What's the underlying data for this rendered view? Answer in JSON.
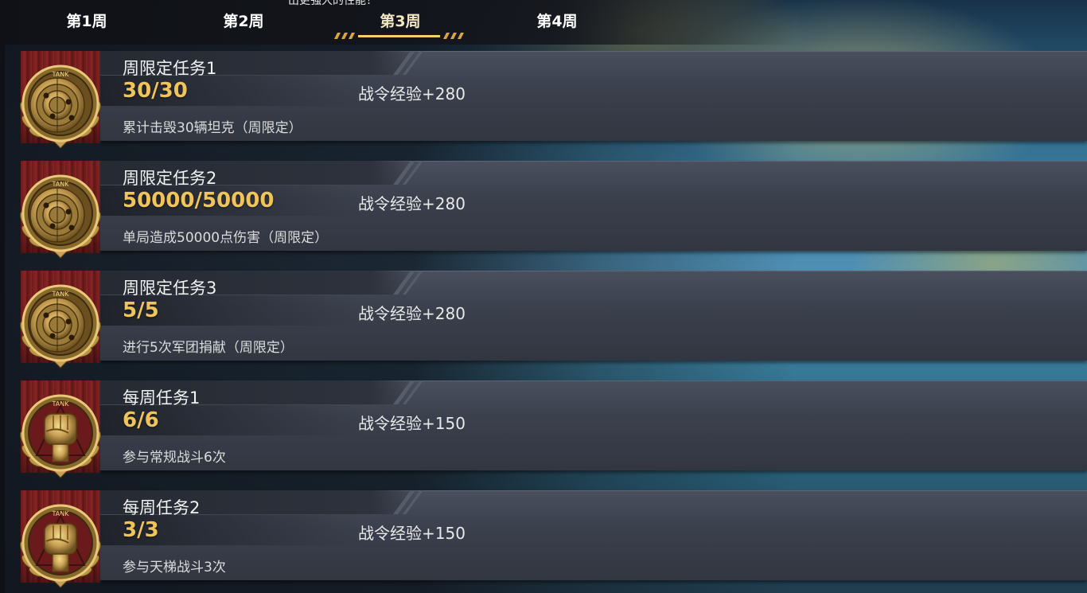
{
  "header": {
    "clipped_text": "出更强大的性能！",
    "tabs": [
      {
        "label": "第1周",
        "selected": false
      },
      {
        "label": "第2周",
        "selected": false
      },
      {
        "label": "第3周",
        "selected": true
      },
      {
        "label": "第4周",
        "selected": false
      }
    ]
  },
  "colors": {
    "progress_gold": "#f0c45b",
    "ribbon_red": "#8a2424",
    "card_grey": "#3b404d",
    "medal_gold": "#c9a054"
  },
  "tasks": [
    {
      "title": "周限定任务1",
      "progress": "30/30",
      "reward": "战令经验+280",
      "description": "累计击毁30辆坦克（周限定）",
      "medal_icon": "target-medal-icon",
      "medal_text": "TANK"
    },
    {
      "title": "周限定任务2",
      "progress": "50000/50000",
      "reward": "战令经验+280",
      "description": "单局造成50000点伤害（周限定）",
      "medal_icon": "target-medal-icon",
      "medal_text": "TANK"
    },
    {
      "title": "周限定任务3",
      "progress": "5/5",
      "reward": "战令经验+280",
      "description": "进行5次军团捐献（周限定）",
      "medal_icon": "target-medal-icon",
      "medal_text": "TANK"
    },
    {
      "title": "每周任务1",
      "progress": "6/6",
      "reward": "战令经验+150",
      "description": "参与常规战斗6次",
      "medal_icon": "fist-medal-icon",
      "medal_text": "TANK"
    },
    {
      "title": "每周任务2",
      "progress": "3/3",
      "reward": "战令经验+150",
      "description": "参与天梯战斗3次",
      "medal_icon": "fist-medal-icon",
      "medal_text": "TANK"
    }
  ]
}
